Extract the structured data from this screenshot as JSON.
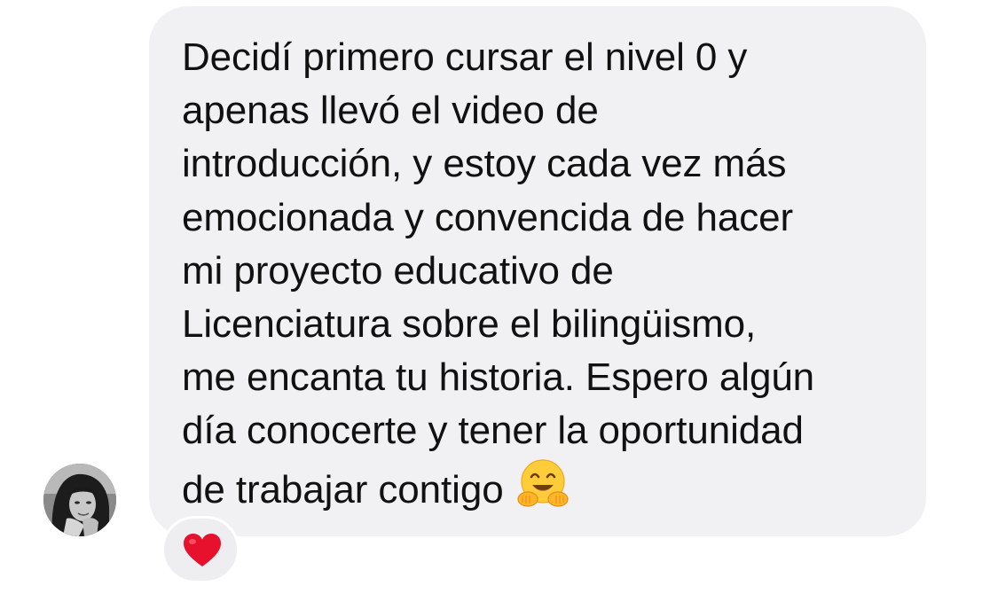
{
  "message": {
    "lines": [
      "Decidí primero cursar el nivel 0 y",
      "apenas llevó el video de",
      "introducción, y estoy cada vez más",
      "emocionada y convencida de hacer",
      "mi proyecto educativo de",
      "Licenciatura sobre el bilingüismo,",
      "me encanta tu historia. Espero algún",
      "día conocerte y tener la oportunidad",
      "de trabajar contigo"
    ],
    "trailing_emoji": "hugging-face-icon",
    "bubble_color": "#f1f1f3",
    "text_color": "#111111"
  },
  "sender": {
    "avatar": "user-avatar"
  },
  "reaction": {
    "icon": "red-heart-icon",
    "color": "#e8112d"
  }
}
